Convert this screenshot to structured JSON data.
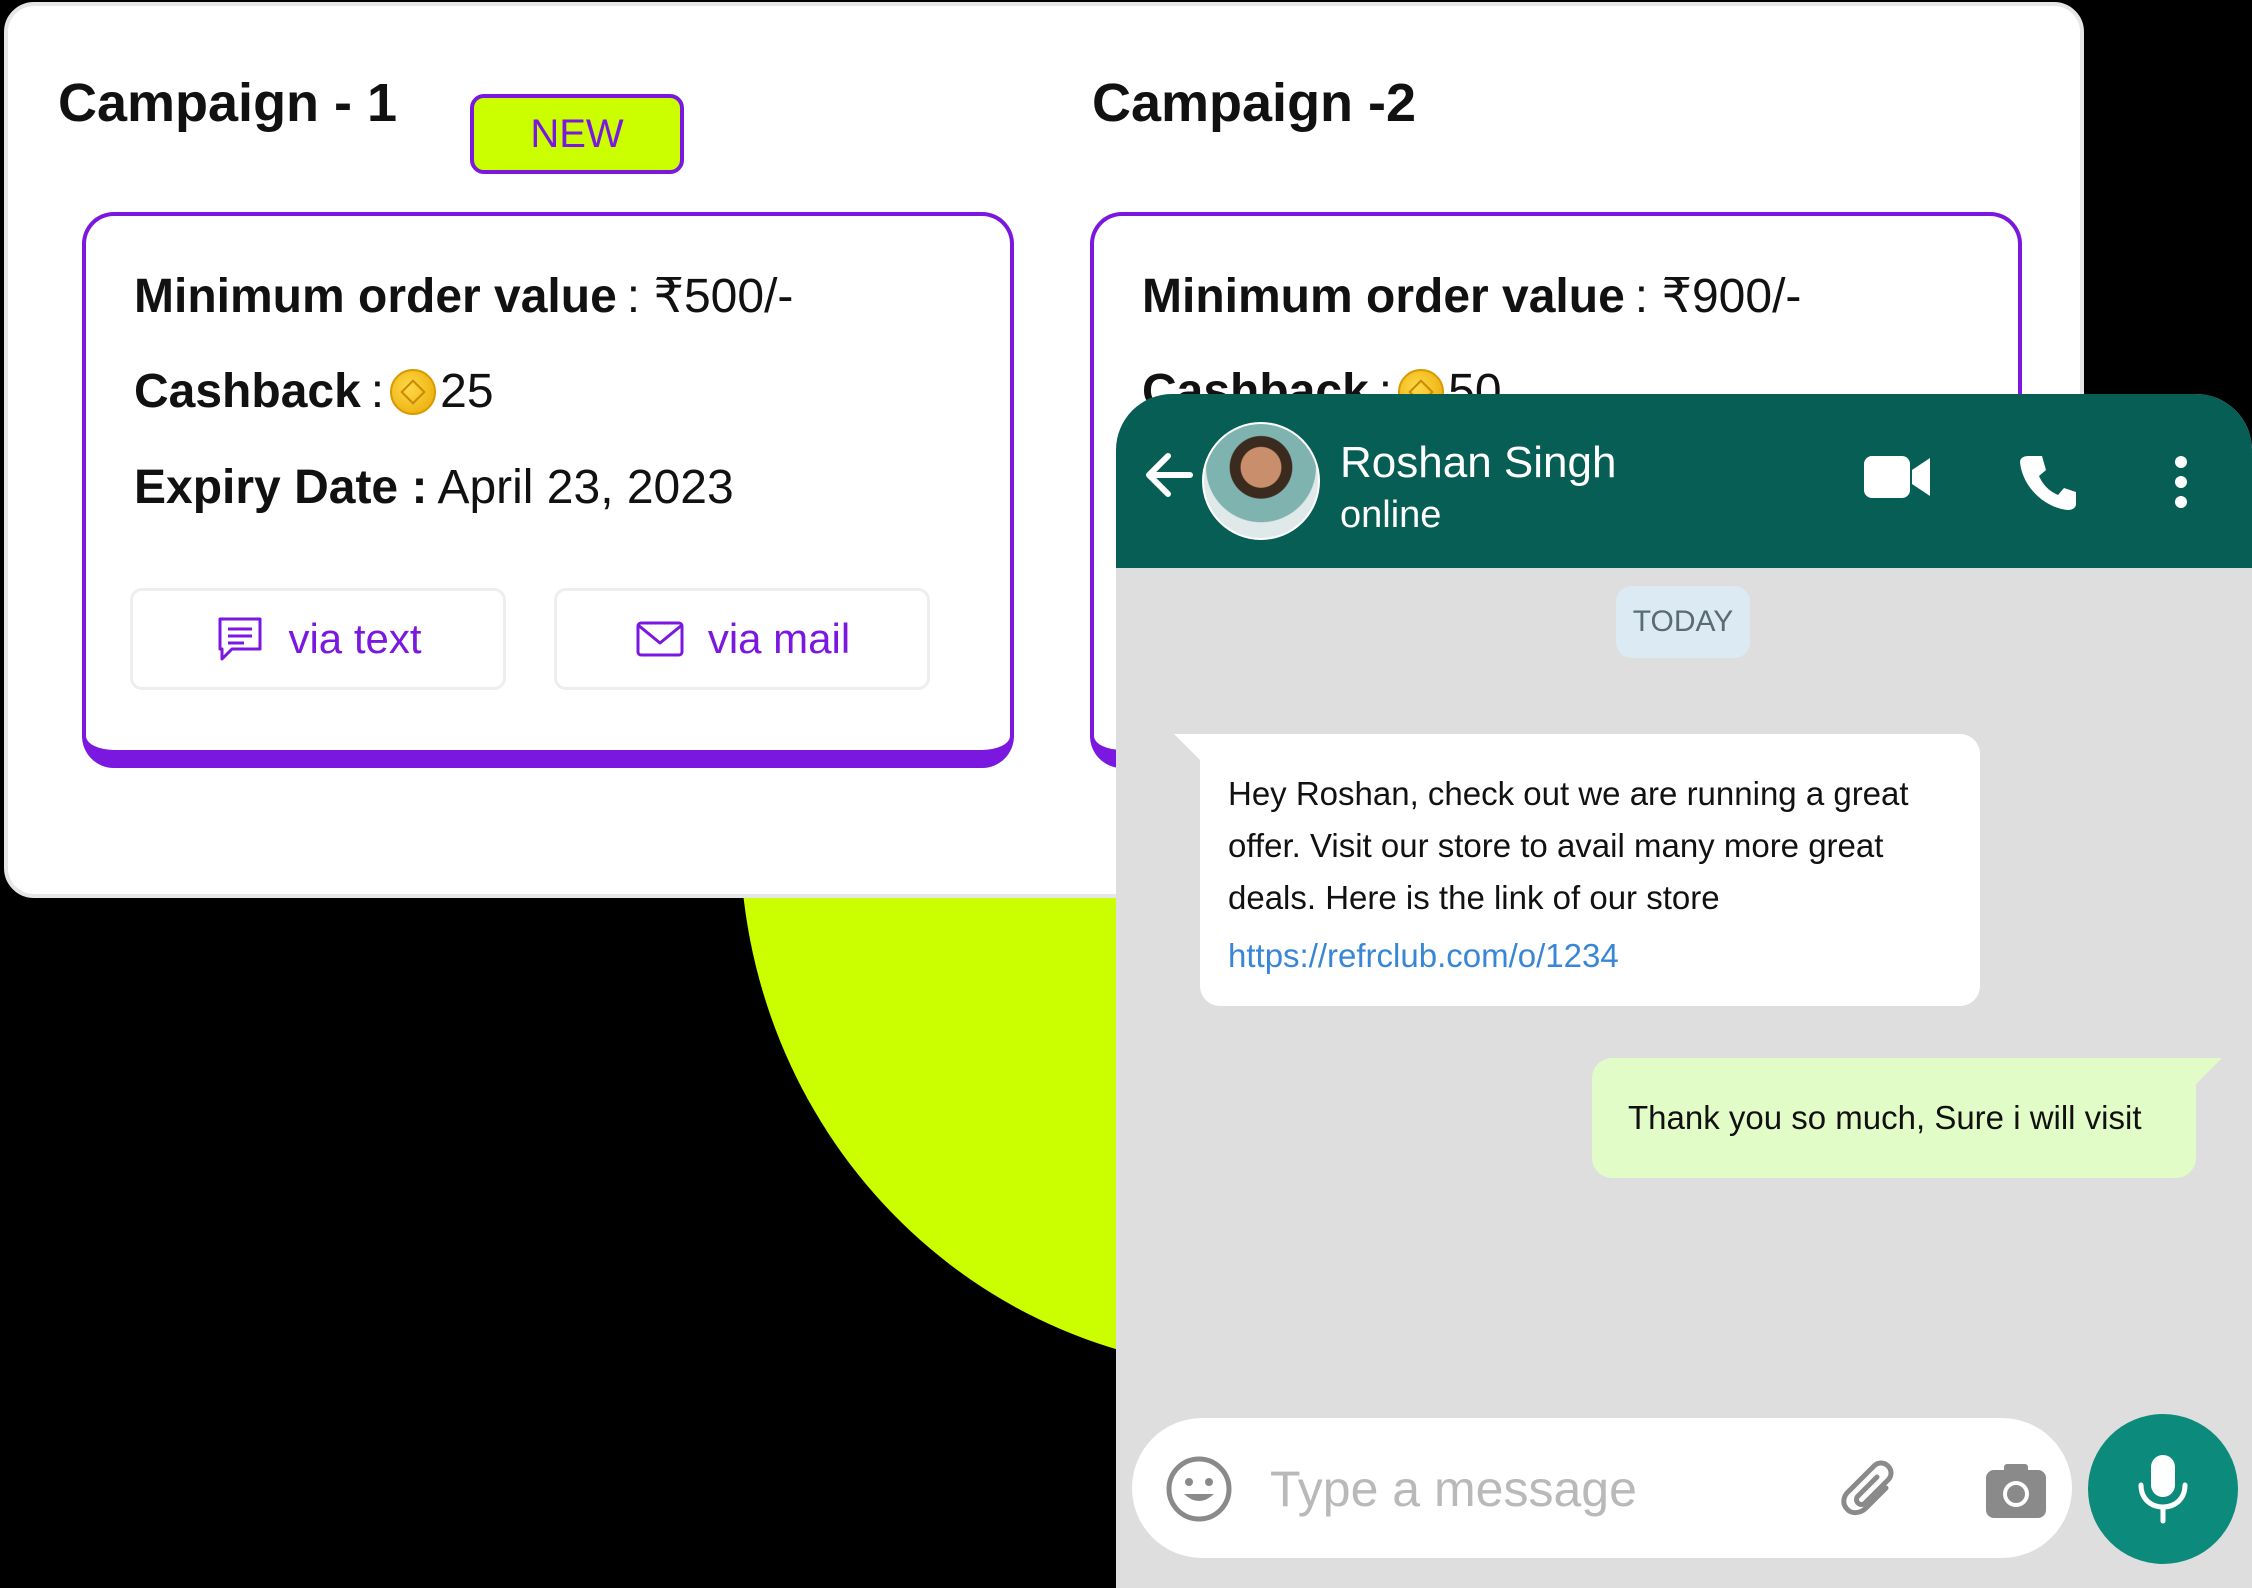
{
  "colors": {
    "accent_purple": "#7a18e0",
    "lime": "#cbff00",
    "whatsapp_header": "#075e54",
    "outgoing_bubble": "#e1fcc6",
    "mic_button": "#0c8a7b",
    "link": "#3a86d6"
  },
  "campaigns": [
    {
      "title": "Campaign - 1",
      "badge": "NEW",
      "min_order_label": "Minimum order value",
      "min_order_value": ": ₹500/-",
      "cashback_label": "Cashback",
      "cashback_colon": ":",
      "cashback_icon": "coin-icon",
      "cashback_value": "25",
      "expiry_label": "Expiry Date :",
      "expiry_value": "April 23, 2023",
      "text_button": "via text",
      "mail_button": "via mail"
    },
    {
      "title": "Campaign -2",
      "min_order_label": "Minimum order value",
      "min_order_value": ": ₹900/-",
      "cashback_label": "Cashback",
      "cashback_colon": ":",
      "cashback_icon": "coin-icon",
      "cashback_value": "50"
    }
  ],
  "chat": {
    "contact_name": "Roshan Singh",
    "status": "online",
    "date_chip": "TODAY",
    "messages": [
      {
        "direction": "incoming",
        "text": "Hey Roshan, check out we are running a great offer. Visit our store to avail many more great deals. Here is the link of our store",
        "link": "https://refrclub.com/o/1234"
      },
      {
        "direction": "outgoing",
        "text": "Thank you so much, Sure i will visit"
      }
    ],
    "input_placeholder": "Type a message",
    "icons": [
      "back-arrow-icon",
      "video-call-icon",
      "phone-icon",
      "more-vertical-icon",
      "emoji-icon",
      "paperclip-icon",
      "camera-icon",
      "microphone-icon"
    ]
  }
}
